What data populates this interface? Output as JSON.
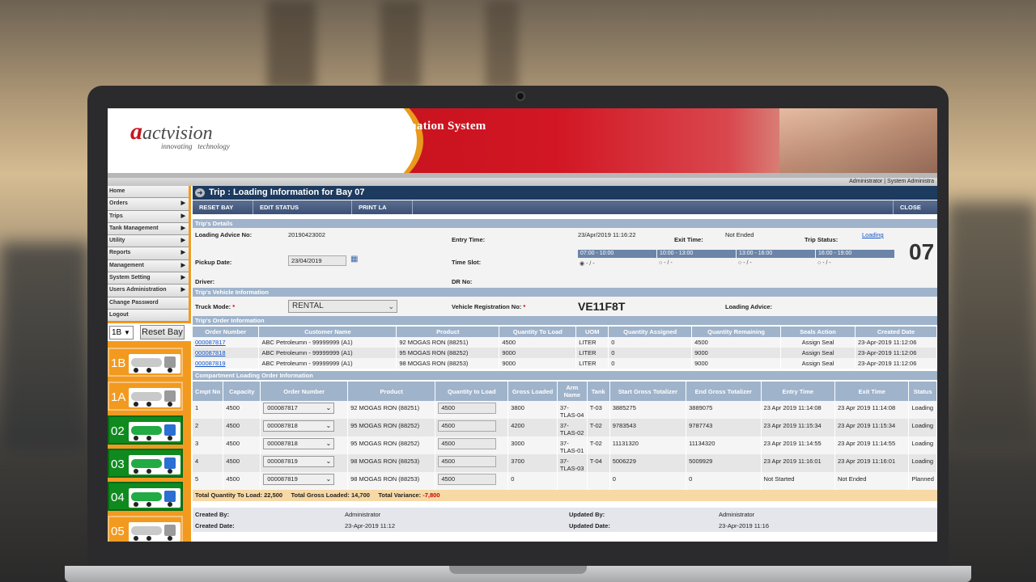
{
  "app": {
    "logo_brand": "actvision",
    "logo_tagline_1": "innovating",
    "logo_tagline_2": "technology",
    "banner_title": "Terminal Automation System",
    "user_info": "Administrator | System Administra"
  },
  "sidebar": {
    "items": [
      {
        "label": "Home",
        "arrow": false
      },
      {
        "label": "Orders",
        "arrow": true
      },
      {
        "label": "Trips",
        "arrow": true
      },
      {
        "label": "Tank Management",
        "arrow": true
      },
      {
        "label": "Utility",
        "arrow": true
      },
      {
        "label": "Reports",
        "arrow": true
      },
      {
        "label": "Management",
        "arrow": true
      },
      {
        "label": "System Setting",
        "arrow": true
      },
      {
        "label": "Users Administration",
        "arrow": true
      },
      {
        "label": "Change Password",
        "arrow": false
      },
      {
        "label": "Logout",
        "arrow": false
      }
    ],
    "bay_select_value": "1B",
    "bay_reset_label": "Reset Bay",
    "bays": [
      {
        "label": "1B",
        "bg": "#f29a1f",
        "tank": "#c9c9c9",
        "cab": "#9a9a9a"
      },
      {
        "label": "1A",
        "bg": "#f29a1f",
        "tank": "#c9c9c9",
        "cab": "#9a9a9a"
      },
      {
        "label": "02",
        "bg": "#0f8a1f",
        "tank": "#22aa44",
        "cab": "#2a6fd1"
      },
      {
        "label": "03",
        "bg": "#0f8a1f",
        "tank": "#22aa44",
        "cab": "#2a6fd1"
      },
      {
        "label": "04",
        "bg": "#0f8a1f",
        "tank": "#22aa44",
        "cab": "#2a6fd1"
      },
      {
        "label": "05",
        "bg": "#f29a1f",
        "tank": "#c9c9c9",
        "cab": "#9a9a9a"
      }
    ]
  },
  "page": {
    "title": "Trip : Loading Information for Bay 07",
    "toolbar": {
      "reset_bay": "RESET BAY",
      "edit_status": "EDIT STATUS",
      "print_la": "PRINT LA",
      "close": "CLOSE"
    }
  },
  "trip_details": {
    "section_title": "Trip's Details",
    "loading_advice_no_label": "Loading Advice No:",
    "loading_advice_no": "20190423002",
    "entry_time_label": "Entry Time:",
    "entry_time": "23/Apr/2019 11:16:22",
    "exit_time_label": "Exit Time:",
    "exit_time": "Not Ended",
    "trip_status_label": "Trip Status:",
    "trip_status": "Loading",
    "pickup_date_label": "Pickup Date:",
    "pickup_date": "23/04/2019",
    "time_slot_label": "Time Slot:",
    "time_slots": [
      {
        "range": "07:00 - 10:00",
        "value": "- / -",
        "checked": true
      },
      {
        "range": "10:00 - 13:00",
        "value": "- / -",
        "checked": false
      },
      {
        "range": "13:00 - 16:00",
        "value": "- / -",
        "checked": false
      },
      {
        "range": "16:00 - 19:00",
        "value": "- / -",
        "checked": false
      }
    ],
    "bay_number": "07",
    "driver_label": "Driver:",
    "dr_no_label": "DR No:"
  },
  "vehicle_info": {
    "section_title": "Trip's Vehicle Information",
    "truck_mode_label": "Truck Mode:",
    "truck_mode": "RENTAL",
    "vehicle_reg_label": "Vehicle Registration No:",
    "vehicle_reg": "VE11F8T",
    "loading_advice_label": "Loading Advice:"
  },
  "order_info": {
    "section_title": "Trip's Order Information",
    "headers": [
      "Order Number",
      "Customer Name",
      "Product",
      "Quantity To Load",
      "UOM",
      "Quantity Assigned",
      "Quantity Remaining",
      "Seals Action",
      "Created Date"
    ],
    "rows": [
      [
        "000087817",
        "ABC Petroleumn - 99999999 (A1)",
        "92 MOGAS RON (88251)",
        "4500",
        "LITER",
        "0",
        "4500",
        "Assign Seal",
        "23-Apr-2019 11:12:06"
      ],
      [
        "000087818",
        "ABC Petroleumn - 99999999 (A1)",
        "95 MOGAS RON (88252)",
        "9000",
        "LITER",
        "0",
        "9000",
        "Assign Seal",
        "23-Apr-2019 11:12:06"
      ],
      [
        "000087819",
        "ABC Petroleumn - 99999999 (A1)",
        "98 MOGAS RON (88253)",
        "9000",
        "LITER",
        "0",
        "9000",
        "Assign Seal",
        "23-Apr-2019 11:12:06"
      ]
    ]
  },
  "compartment_info": {
    "section_title": "Compartment Loading Order Information",
    "headers": [
      "Cmpt No",
      "Capacity",
      "Order Number",
      "Product",
      "Quantity to Load",
      "Gross Loaded",
      "Arm Name",
      "Tank",
      "Start Gross Totalizer",
      "End Gross Totalizer",
      "Entry Time",
      "Exit Time",
      "Status"
    ],
    "rows": [
      [
        "1",
        "4500",
        "000087817",
        "92 MOGAS RON (88251)",
        "4500",
        "3800",
        "37-TLAS-04",
        "T-03",
        "3885275",
        "3889075",
        "23 Apr 2019 11:14:08",
        "23 Apr 2019 11:14:08",
        "Loading"
      ],
      [
        "2",
        "4500",
        "000087818",
        "95 MOGAS RON (88252)",
        "4500",
        "4200",
        "37-TLAS-02",
        "T-02",
        "9783543",
        "9787743",
        "23 Apr 2019 11:15:34",
        "23 Apr 2019 11:15:34",
        "Loading"
      ],
      [
        "3",
        "4500",
        "000087818",
        "95 MOGAS RON (88252)",
        "4500",
        "3000",
        "37-TLAS-01",
        "T-02",
        "11131320",
        "11134320",
        "23 Apr 2019 11:14:55",
        "23 Apr 2019 11:14:55",
        "Loading"
      ],
      [
        "4",
        "4500",
        "000087819",
        "98 MOGAS RON (88253)",
        "4500",
        "3700",
        "37-TLAS-03",
        "T-04",
        "5006229",
        "5009929",
        "23 Apr 2019 11:16:01",
        "23 Apr 2019 11:16:01",
        "Loading"
      ],
      [
        "5",
        "4500",
        "000087819",
        "98 MOGAS RON (88253)",
        "4500",
        "0",
        "",
        "",
        "0",
        "0",
        "Not Started",
        "Not Ended",
        "Planned"
      ]
    ],
    "total_qty_label": "Total Quantity To Load:",
    "total_qty": "22,500",
    "total_gross_label": "Total Gross Loaded:",
    "total_gross": "14,700",
    "total_variance_label": "Total Variance:",
    "total_variance": "-7,800"
  },
  "audit": {
    "created_by_label": "Created By:",
    "created_by": "Administrator",
    "created_date_label": "Created Date:",
    "created_date": "23-Apr-2019 11:12",
    "updated_by_label": "Updated By:",
    "updated_by": "Administrator",
    "updated_date_label": "Updated Date:",
    "updated_date": "23-Apr-2019 11:16"
  }
}
